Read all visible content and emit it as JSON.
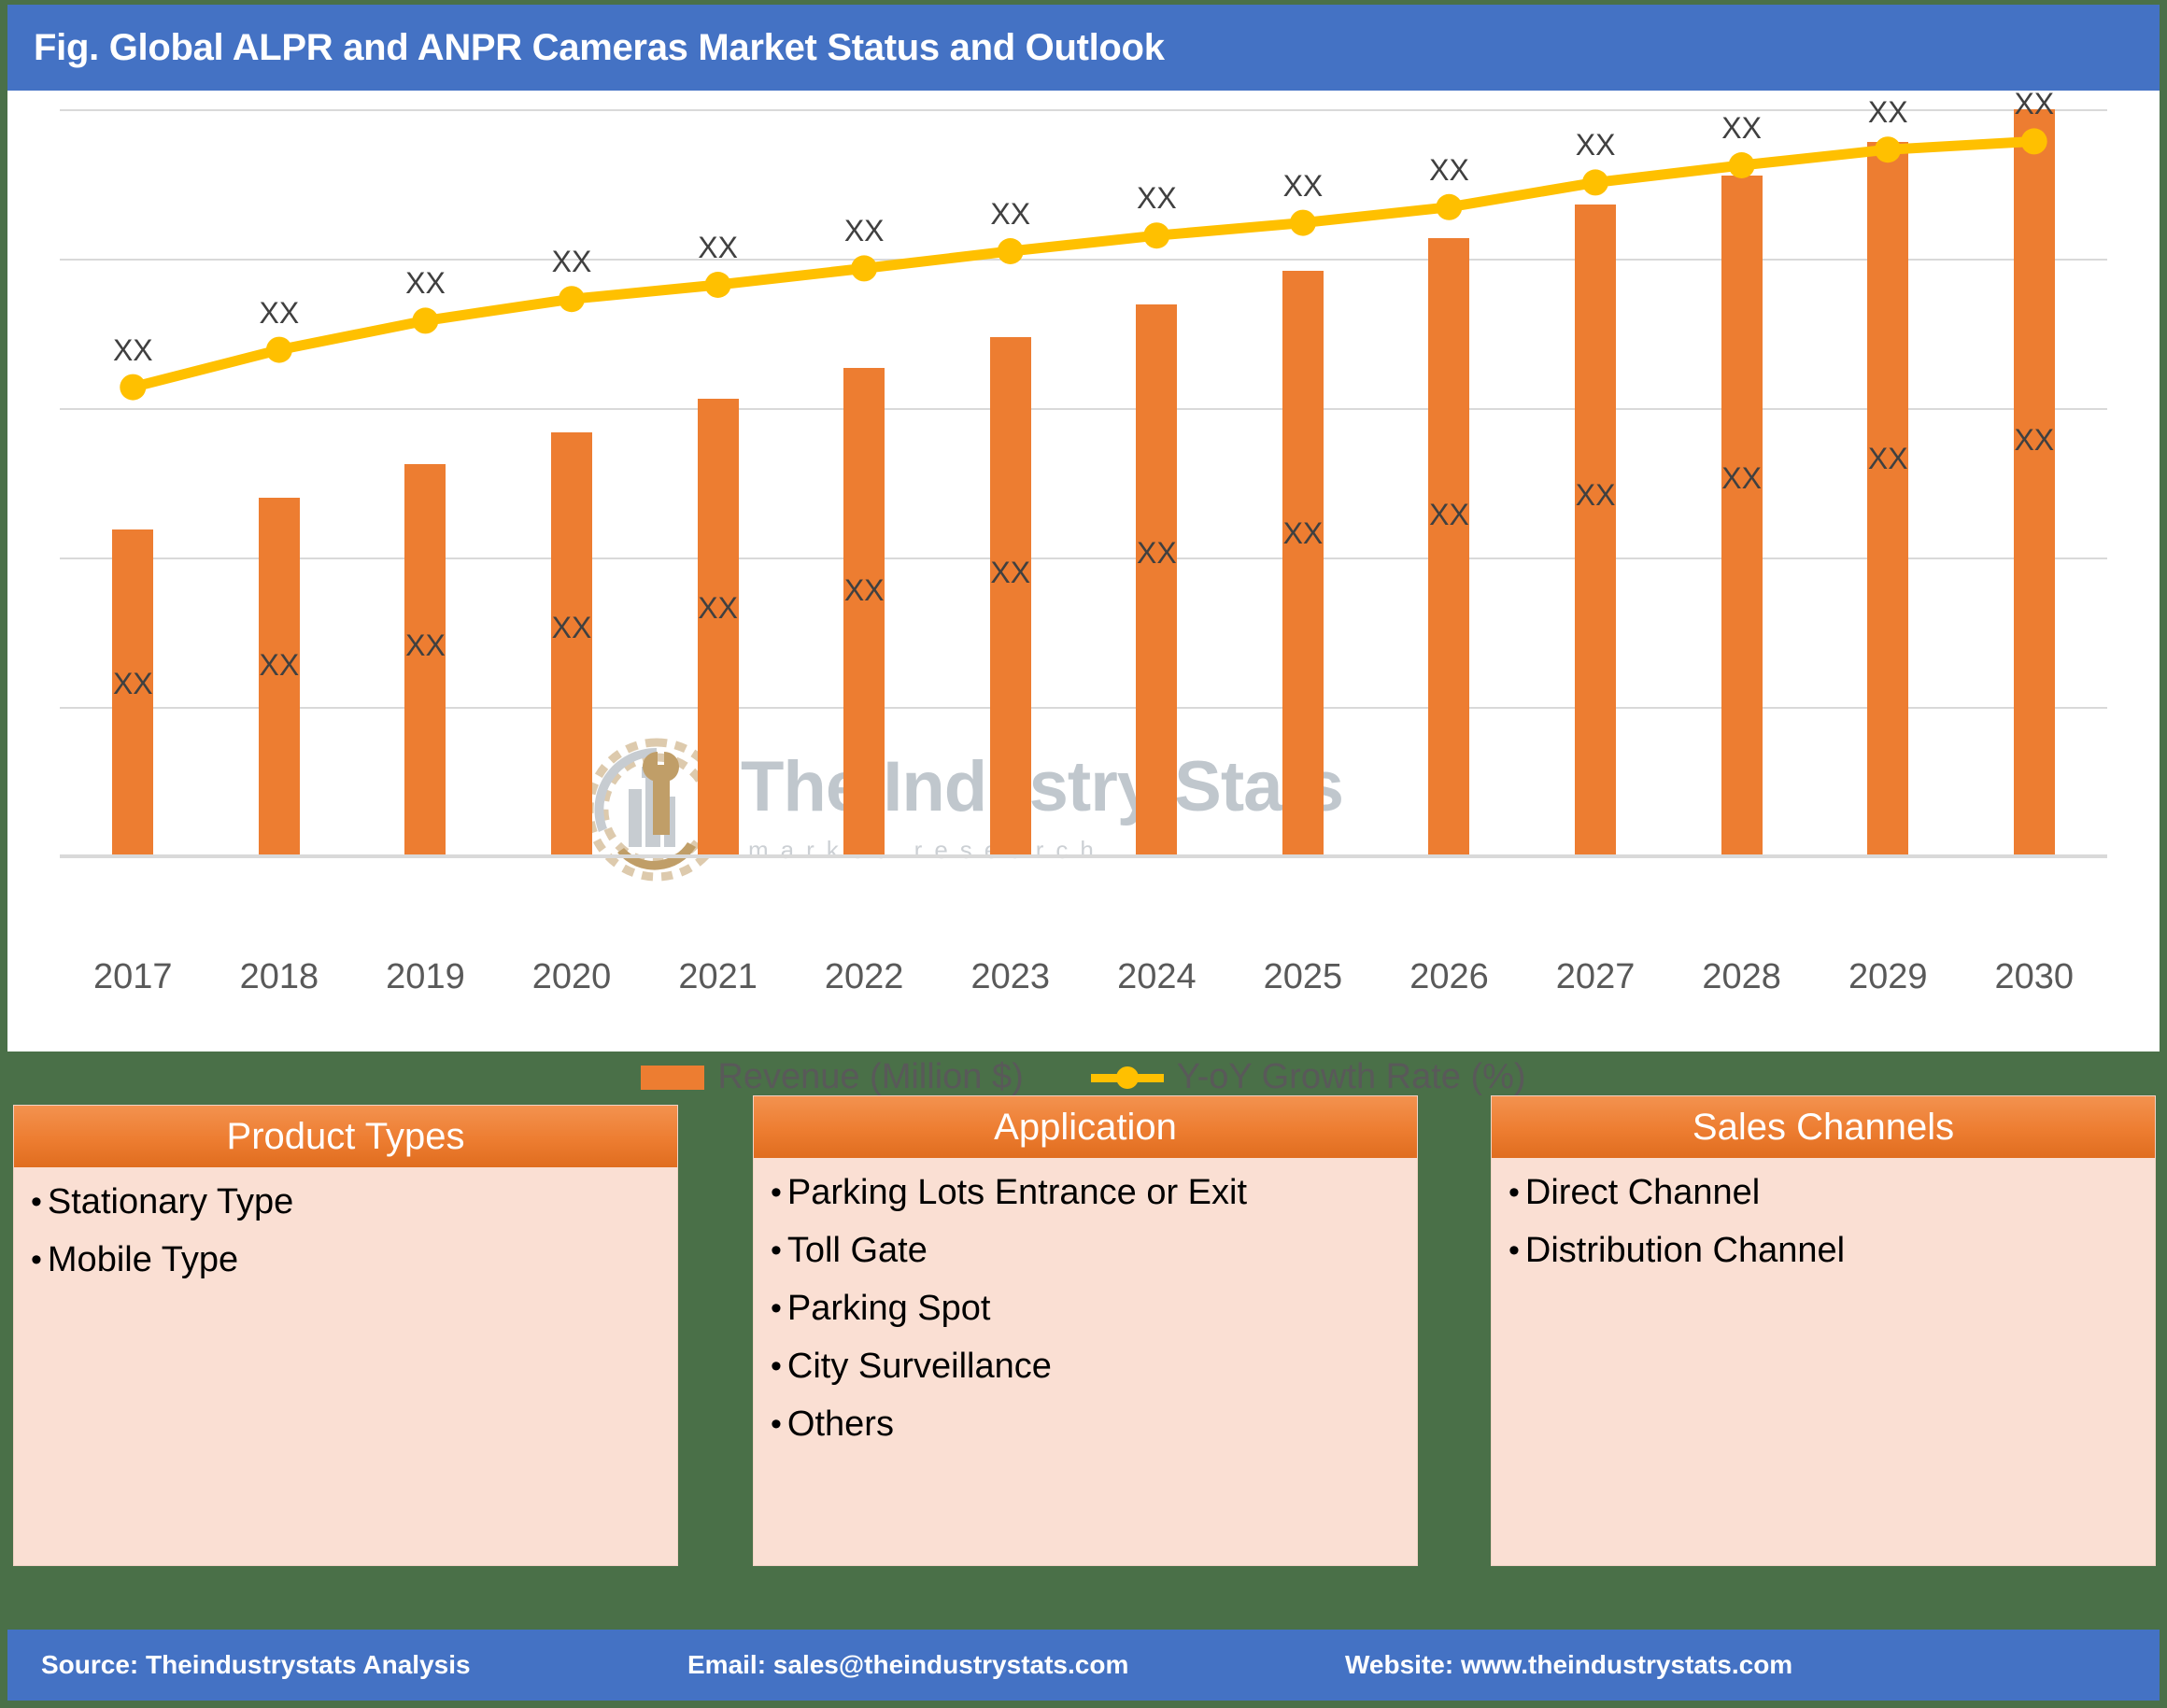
{
  "header": {
    "title": "Fig. Global ALPR and ANPR Cameras Market Status and Outlook"
  },
  "watermark": {
    "title": "The Industry Stats",
    "subtitle": "market research",
    "logo_icon": "gear-factory-logo-icon"
  },
  "chart_data": {
    "type": "bar",
    "title": "Fig. Global ALPR and ANPR Cameras Market Status and Outlook",
    "xlabel": "",
    "ylabel": "",
    "grid": true,
    "legend_position": "bottom",
    "value_labels_masked": "XX",
    "categories": [
      "2017",
      "2018",
      "2019",
      "2020",
      "2021",
      "2022",
      "2023",
      "2024",
      "2025",
      "2026",
      "2027",
      "2028",
      "2029",
      "2030"
    ],
    "ylim": [
      0,
      100
    ],
    "series": [
      {
        "name": "Revenue (Million $)",
        "type": "bar",
        "color": "#ED7D31",
        "values": [
          43.8,
          48.0,
          52.5,
          56.7,
          61.2,
          65.4,
          69.5,
          73.9,
          78.4,
          82.8,
          87.3,
          91.1,
          95.6,
          100.0
        ],
        "labels": [
          "XX",
          "XX",
          "XX",
          "XX",
          "XX",
          "XX",
          "XX",
          "XX",
          "XX",
          "XX",
          "XX",
          "XX",
          "XX",
          "XX"
        ]
      },
      {
        "name": "Y-oY Growth Rate (%)",
        "type": "line",
        "color": "#FFC000",
        "values": [
          62.8,
          67.8,
          71.7,
          74.6,
          76.5,
          78.7,
          81.0,
          83.1,
          84.8,
          86.9,
          90.2,
          92.5,
          94.6,
          95.7
        ],
        "labels": [
          "XX",
          "XX",
          "XX",
          "XX",
          "XX",
          "XX",
          "XX",
          "XX",
          "XX",
          "XX",
          "XX",
          "XX",
          "XX",
          "XX"
        ]
      }
    ],
    "gridline_values": [
      100,
      80,
      60,
      40,
      20,
      0
    ]
  },
  "panels": [
    {
      "title": "Product Types",
      "items": [
        "Stationary Type",
        "Mobile Type"
      ]
    },
    {
      "title": "Application",
      "items": [
        "Parking Lots Entrance or Exit",
        "Toll Gate",
        "Parking Spot",
        "City Surveillance",
        "Others"
      ]
    },
    {
      "title": "Sales Channels",
      "items": [
        "Direct Channel",
        "Distribution Channel"
      ]
    }
  ],
  "footer": {
    "source": "Source: Theindustrystats Analysis",
    "email": "Email: sales@theindustrystats.com",
    "website": "Website: www.theindustrystats.com"
  },
  "colors": {
    "title_bar": "#4472C4",
    "page_background": "#4A7048",
    "bar": "#ED7D31",
    "line": "#FFC000",
    "panel_body": "#FADFD3",
    "panel_header": "#ED7D31",
    "gridline": "#D9D9D9"
  }
}
